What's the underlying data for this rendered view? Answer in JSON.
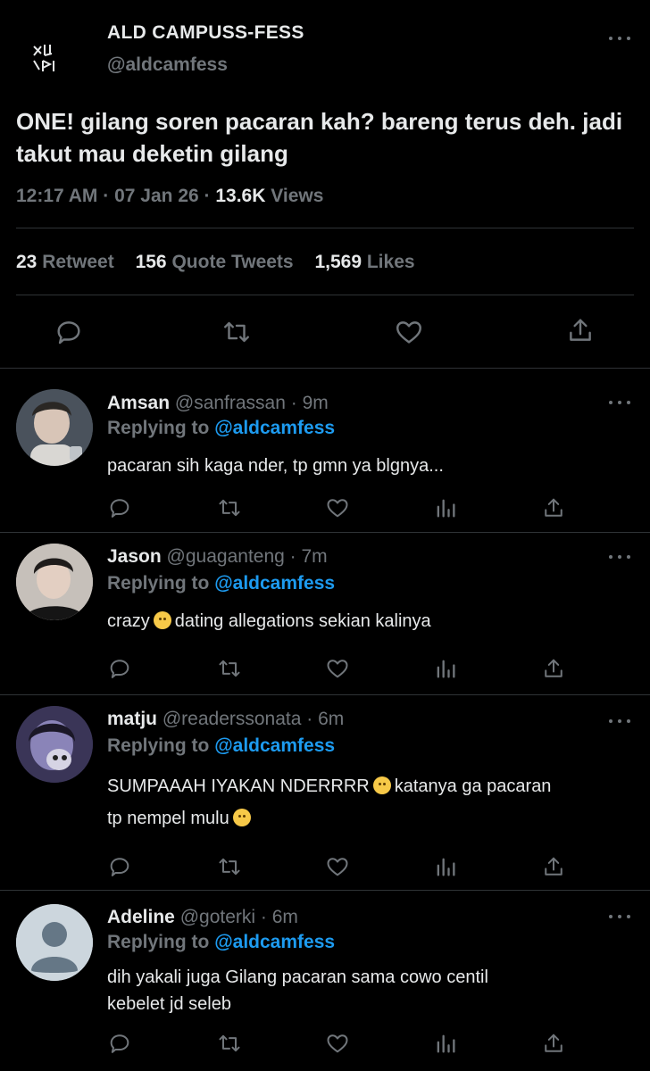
{
  "main": {
    "name": "ALD CAMPUSS-FESS",
    "handle": "@aldcamfess",
    "text": "ONE! gilang soren pacaran kah? bareng terus deh. jadi takut mau deketin gilang",
    "time": "12:17 AM",
    "date": "07 Jan 26",
    "views_count": "13.6K",
    "views_label": "Views",
    "retweet_count": "23",
    "retweet_label": "Retweet",
    "quote_count": "156",
    "quote_label": "Quote Tweets",
    "likes_count": "1,569",
    "likes_label": "Likes",
    "avatar_text": "ALD"
  },
  "replying_prefix": "Replying to",
  "replying_handle": "@aldcamfess",
  "replies": [
    {
      "name": "Amsan",
      "handle": "@sanfrassan",
      "time": "9m",
      "text": "pacaran sih kaga nder, tp gmn ya blgnya..."
    },
    {
      "name": "Jason",
      "handle": "@guaganteng",
      "time": "7m",
      "text_before": "crazy",
      "text_after": "dating allegations sekian kalinya"
    },
    {
      "name": "matju",
      "handle": "@readerssonata",
      "time": "6m",
      "line1_before": "SUMPAAAH IYAKAN NDERRRR",
      "line1_after": "katanya ga pacaran",
      "line2": "tp nempel mulu"
    },
    {
      "name": "Adeline",
      "handle": "@goterki",
      "time": "6m",
      "line1": "dih yakali juga Gilang pacaran sama cowo centil",
      "line2": "kebelet jd seleb"
    }
  ],
  "colors": {
    "background": "#000000",
    "text": "#e7e9ea",
    "muted": "#71767b",
    "link": "#1d9bf0",
    "divider": "#2f3336"
  }
}
